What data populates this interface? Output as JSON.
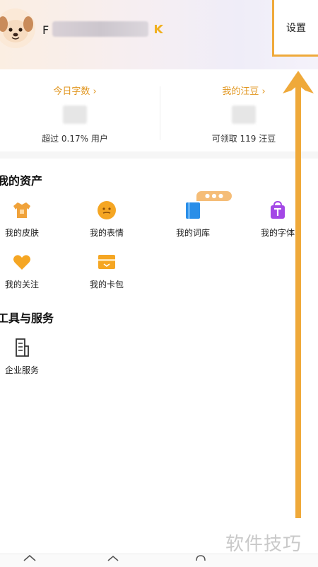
{
  "header": {
    "username_initial": "F",
    "settings_label": "设置"
  },
  "stats": {
    "left": {
      "title": "今日字数 ›",
      "desc": "超过 0.17% 用户"
    },
    "right": {
      "title": "我的汪豆 ›",
      "desc": "可领取 119 汪豆"
    }
  },
  "assets": {
    "title": "我的资产",
    "items": [
      {
        "label": "我的皮肤",
        "icon": "tshirt-icon"
      },
      {
        "label": "我的表情",
        "icon": "emoji-icon"
      },
      {
        "label": "我的词库",
        "icon": "book-icon"
      },
      {
        "label": "我的字体",
        "icon": "font-bag-icon"
      },
      {
        "label": "我的关注",
        "icon": "heart-icon"
      },
      {
        "label": "我的卡包",
        "icon": "card-icon"
      }
    ]
  },
  "tools": {
    "title": "工具与服务",
    "items": [
      {
        "label": "企业服务",
        "icon": "document-icon"
      }
    ]
  },
  "watermark": "软件技巧",
  "colors": {
    "accent": "#e1961f",
    "annotation": "#efa93a",
    "font_purple": "#a347e6",
    "book_blue": "#2a8ee8"
  }
}
